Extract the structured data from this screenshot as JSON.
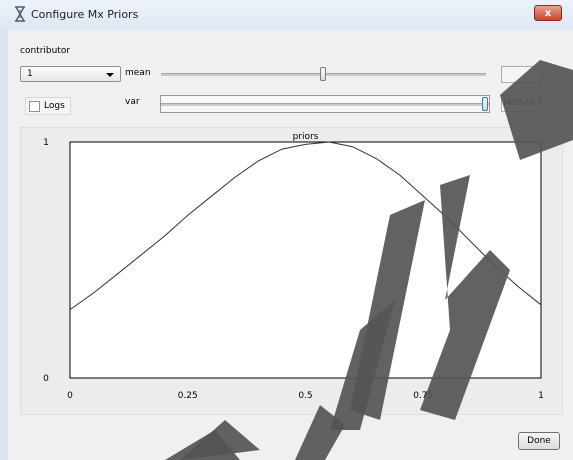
{
  "window": {
    "title": "Configure Mx Priors",
    "close_label": "x"
  },
  "controls": {
    "contributor_label": "contributor",
    "contributor_value": "1",
    "mean_label": "mean",
    "var_label": "var",
    "logs_label": "Logs",
    "logs_checked": false,
    "mean_slider_level": 0.5,
    "var_slider_level": 1.0,
    "mean_value": "",
    "var_value": ")48576.0"
  },
  "chart_data": {
    "type": "line",
    "title": "priors",
    "xlabel": "",
    "ylabel": "",
    "xlim": [
      0,
      1
    ],
    "ylim": [
      0,
      1
    ],
    "x_ticks": [
      "0",
      "0.25",
      "0.5",
      "0.75",
      "1"
    ],
    "y_ticks": [
      "0",
      "1"
    ],
    "series": [
      {
        "x": [
          0,
          0.05,
          0.1,
          0.15,
          0.2,
          0.25,
          0.3,
          0.35,
          0.4,
          0.45,
          0.5,
          0.55,
          0.6,
          0.65,
          0.7,
          0.75,
          0.8,
          0.85,
          0.9,
          0.95,
          1.0
        ],
        "y": [
          0.29,
          0.36,
          0.44,
          0.52,
          0.6,
          0.69,
          0.77,
          0.85,
          0.92,
          0.97,
          0.99,
          1.0,
          0.98,
          0.93,
          0.86,
          0.77,
          0.68,
          0.58,
          0.48,
          0.39,
          0.31
        ],
        "color": "#333333"
      }
    ]
  },
  "actions": {
    "done_label": "Done"
  },
  "watermark": {
    "text": "ARCHIVE",
    "color": "#555555"
  }
}
